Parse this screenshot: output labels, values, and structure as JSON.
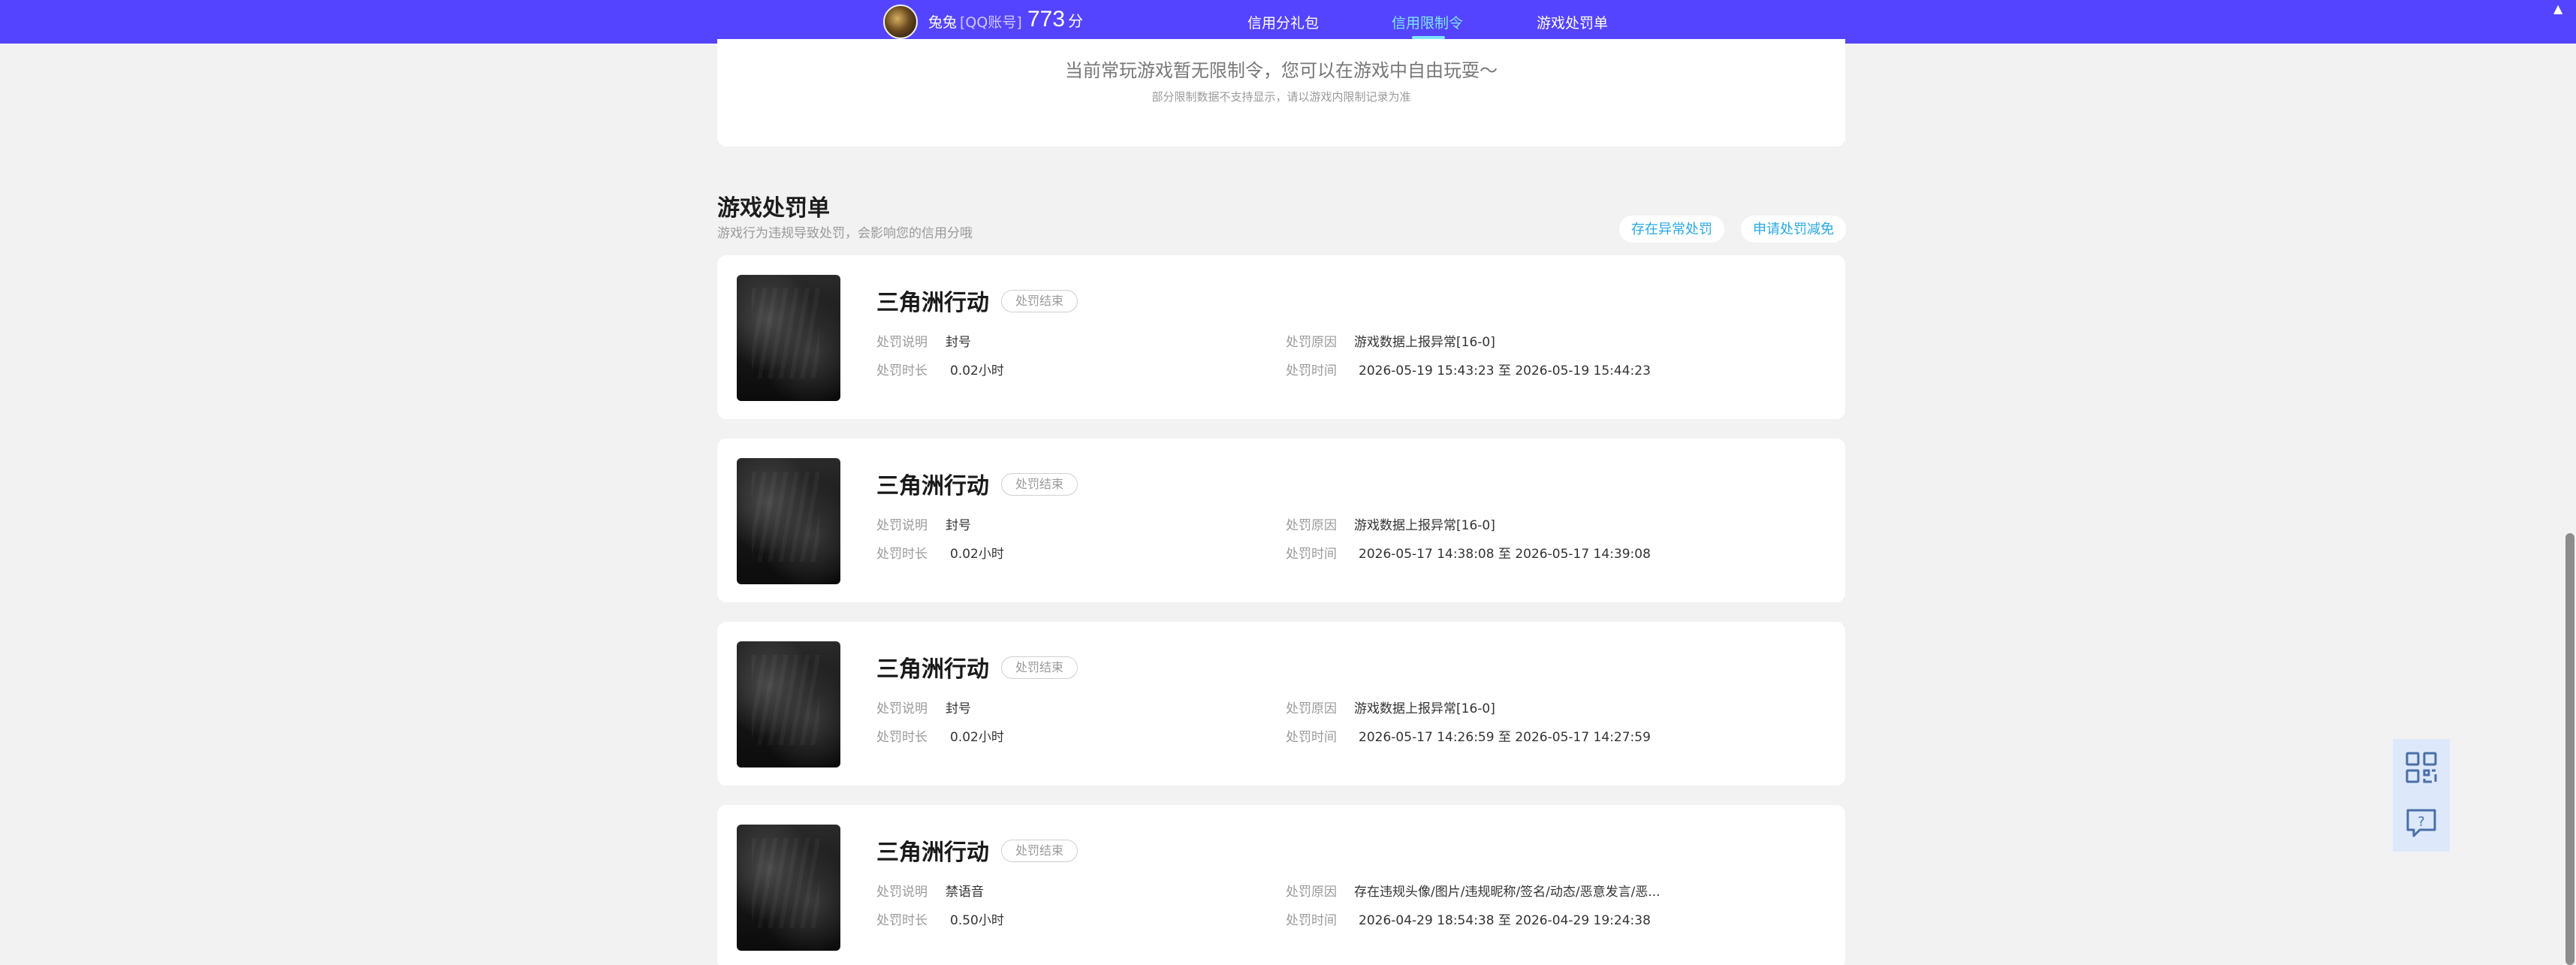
{
  "header": {
    "username": "兔兔",
    "account_type": "[QQ账号]",
    "score": "773",
    "score_unit": "分",
    "nav": [
      {
        "label": "信用分礼包",
        "active": false
      },
      {
        "label": "信用限制令",
        "active": true
      },
      {
        "label": "游戏处罚单",
        "active": false
      }
    ],
    "colors": {
      "bar": "#5544ff",
      "active_link": "#7ee6ff"
    }
  },
  "status": {
    "message": "当前常玩游戏暂无限制令，您可以在游戏中自由玩耍～",
    "note": "部分限制数据不支持显示，请以游戏内限制记录为准"
  },
  "section": {
    "title": "游戏处罚单",
    "description": "游戏行为违规导致处罚，会影响您的信用分哦",
    "buttons": [
      "存在异常处罚",
      "申请处罚减免"
    ]
  },
  "labels": {
    "desc": "处罚说明",
    "reason": "处罚原因",
    "duration": "处罚时长",
    "time": "处罚时间"
  },
  "penalties": [
    {
      "game": "三角洲行动",
      "state": "处罚结束",
      "desc": "封号",
      "reason": "游戏数据上报异常[16-0]",
      "duration": "0.02小时",
      "time": "2026-05-19 15:43:23 至 2026-05-19 15:44:23"
    },
    {
      "game": "三角洲行动",
      "state": "处罚结束",
      "desc": "封号",
      "reason": "游戏数据上报异常[16-0]",
      "duration": "0.02小时",
      "time": "2026-05-17 14:38:08 至 2026-05-17 14:39:08"
    },
    {
      "game": "三角洲行动",
      "state": "处罚结束",
      "desc": "封号",
      "reason": "游戏数据上报异常[16-0]",
      "duration": "0.02小时",
      "time": "2026-05-17 14:26:59 至 2026-05-17 14:27:59"
    },
    {
      "game": "三角洲行动",
      "state": "处罚结束",
      "desc": "禁语音",
      "reason": "存在违规头像/图片/违规昵称/签名/动态/恶意发言/恶...",
      "duration": "0.50小时",
      "time": "2026-04-29 18:54:38 至 2026-04-29 19:24:38"
    }
  ],
  "side_buttons": [
    {
      "icon": "qr-code-icon"
    },
    {
      "icon": "help-chat-icon"
    }
  ]
}
